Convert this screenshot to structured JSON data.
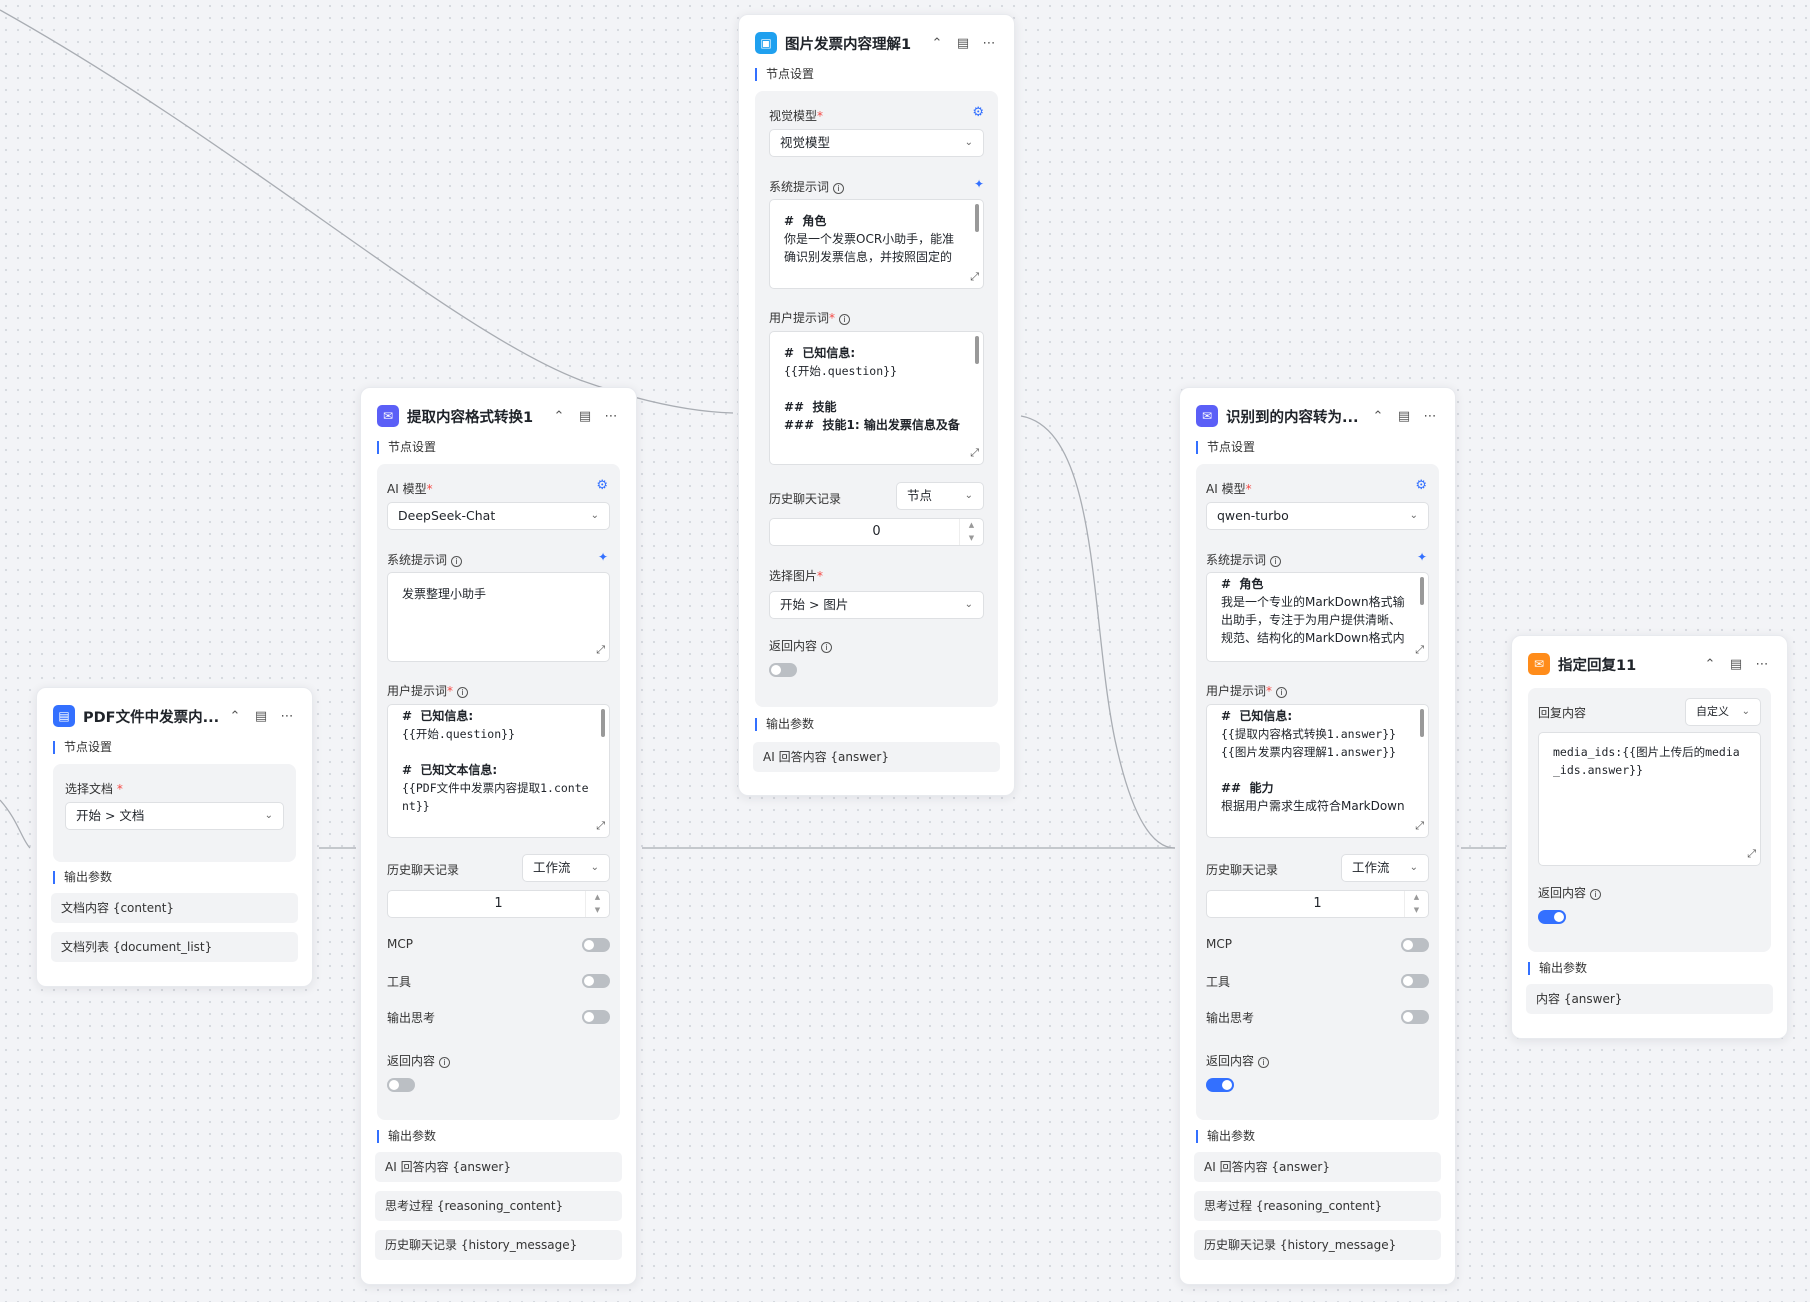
{
  "colors": {
    "accent": "#3370ff",
    "doc_icon": "#3370ff",
    "ai_icon": "#5b5ff7",
    "image_icon": "#1fa0ef",
    "reply_icon": "#ff8c1a",
    "toggle_off": "#bbbfc4"
  },
  "node_pdf": {
    "icon": "document-icon",
    "title": "PDF文件中发票内...",
    "section": "节点设置",
    "select_doc_label": "选择文档",
    "select_doc_value": "开始 > 文档",
    "output_label": "输出参数",
    "outputs": [
      "文档内容 {content}",
      "文档列表 {document_list}"
    ]
  },
  "node_extract": {
    "icon": "chat-icon",
    "title": "提取内容格式转换1",
    "section": "节点设置",
    "model_label": "AI 模型",
    "model_value": "DeepSeek-Chat",
    "system_prompt_label": "系统提示词",
    "system_prompt_text": "发票整理小助手",
    "user_prompt_label": "用户提示词",
    "user_prompt_lines": [
      {
        "h": "#  已知信息:",
        "t": "{{开始.question}}"
      },
      {
        "h": "#  已知文本信息:",
        "t": "{{PDF文件中发票内容提取1.content}}"
      }
    ],
    "history_label": "历史聊天记录",
    "history_mode": "工作流",
    "history_count": "1",
    "mcp_label": "MCP",
    "tools_label": "工具",
    "think_label": "输出思考",
    "return_label": "返回内容",
    "output_label": "输出参数",
    "outputs": [
      "AI 回答内容 {answer}",
      "思考过程 {reasoning_content}",
      "历史聊天记录 {history_message}"
    ]
  },
  "node_image": {
    "icon": "image-icon",
    "title": "图片发票内容理解1",
    "section": "节点设置",
    "vision_label": "视觉模型",
    "vision_value": "视觉模型",
    "system_prompt_label": "系统提示词",
    "system_prompt_head": "#  角色",
    "system_prompt_body": "你是一个发票OCR小助手，能准确识别发票信息，并按照固定的",
    "user_prompt_label": "用户提示词",
    "user_prompt_head1": "#  已知信息:",
    "user_prompt_body1": "{{开始.question}}",
    "user_prompt_head2": "##  技能",
    "user_prompt_head3": "###  技能1: 输出发票信息及备",
    "history_label": "历史聊天记录",
    "history_mode": "节点",
    "history_count": "0",
    "image_label": "选择图片",
    "image_value": "开始 > 图片",
    "return_label": "返回内容",
    "output_label": "输出参数",
    "outputs": [
      "AI 回答内容 {answer}"
    ]
  },
  "node_convert": {
    "icon": "chat-icon",
    "title": "识别到的内容转为...",
    "section": "节点设置",
    "model_label": "AI 模型",
    "model_value": "qwen-turbo",
    "system_prompt_label": "系统提示词",
    "system_prompt_head": "#  角色",
    "system_prompt_body": "我是一个专业的MarkDown格式输出助手，专注于为用户提供清晰、规范、结构化的MarkDown格式内",
    "user_prompt_label": "用户提示词",
    "user_prompt_head1": "#  已知信息:",
    "user_prompt_body1": "{{提取内容格式转换1.answer}}\n{{图片发票内容理解1.answer}}",
    "user_prompt_head2": "##  能力",
    "user_prompt_body2": "根据用户需求生成符合MarkDown",
    "history_label": "历史聊天记录",
    "history_mode": "工作流",
    "history_count": "1",
    "mcp_label": "MCP",
    "tools_label": "工具",
    "think_label": "输出思考",
    "return_label": "返回内容",
    "output_label": "输出参数",
    "outputs": [
      "AI 回答内容 {answer}",
      "思考过程 {reasoning_content}",
      "历史聊天记录 {history_message}"
    ]
  },
  "node_reply": {
    "icon": "reply-icon",
    "title": "指定回复11",
    "reply_label": "回复内容",
    "reply_mode": "自定义",
    "reply_text": "media_ids:{{图片上传后的media_ids.answer}}",
    "return_label": "返回内容",
    "output_label": "输出参数",
    "outputs": [
      "内容 {answer}"
    ]
  },
  "toggles": {
    "extract_mcp": false,
    "extract_tools": false,
    "extract_think": false,
    "extract_return": false,
    "image_return": false,
    "convert_mcp": false,
    "convert_tools": false,
    "convert_think": false,
    "convert_return": true,
    "reply_return": true
  }
}
